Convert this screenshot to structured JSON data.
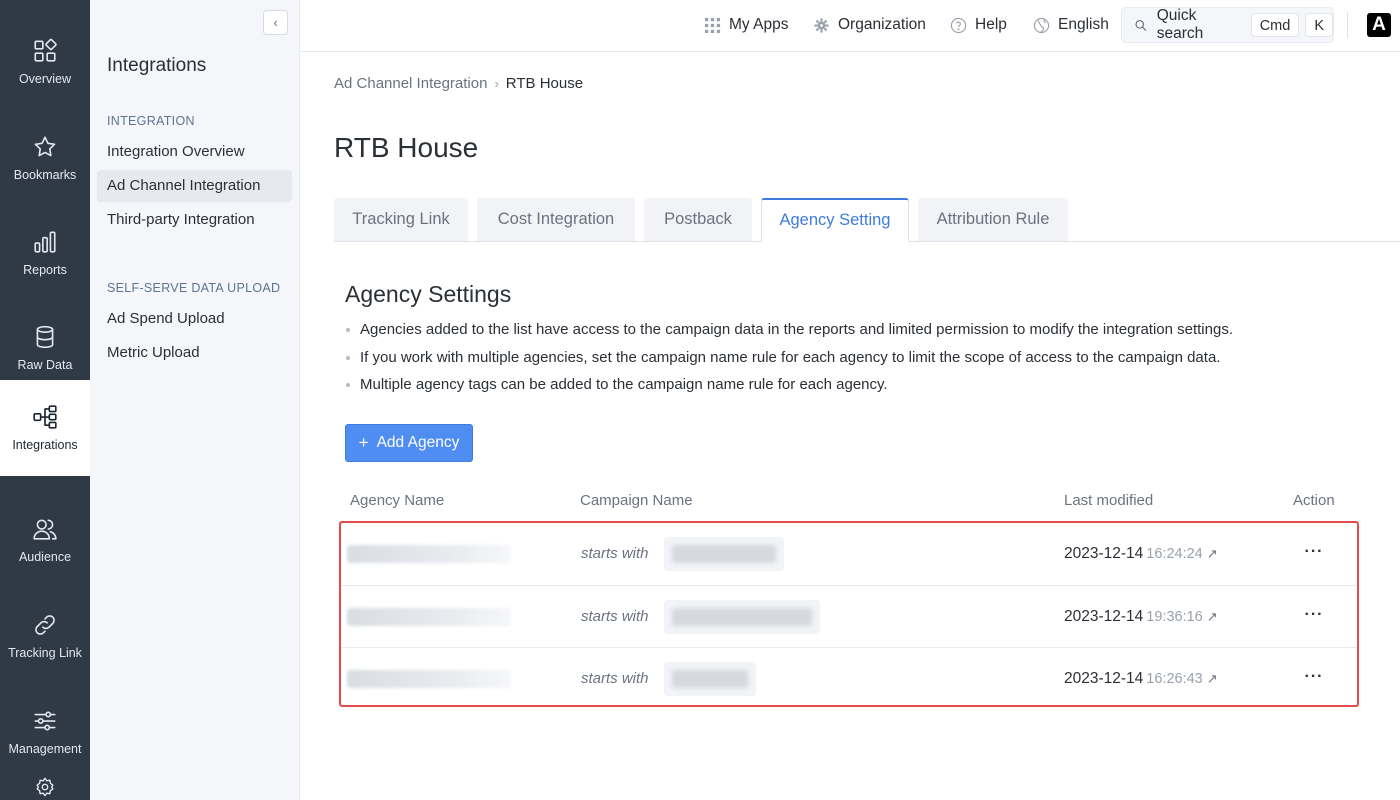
{
  "rail": {
    "items": [
      {
        "label": "Overview",
        "icon": "overview-icon"
      },
      {
        "label": "Bookmarks",
        "icon": "star-icon"
      },
      {
        "label": "Reports",
        "icon": "bar-chart-icon"
      },
      {
        "label": "Raw Data",
        "icon": "database-icon"
      },
      {
        "label": "Integrations",
        "icon": "integrations-icon",
        "active": true
      },
      {
        "label": "Audience",
        "icon": "people-icon"
      },
      {
        "label": "Tracking Link",
        "icon": "link-icon"
      },
      {
        "label": "Management",
        "icon": "sliders-icon"
      }
    ]
  },
  "sidebar": {
    "title": "Integrations",
    "sections": [
      {
        "heading": "INTEGRATION",
        "links": [
          "Integration Overview",
          "Ad Channel Integration",
          "Third-party Integration"
        ]
      },
      {
        "heading": "SELF-SERVE DATA UPLOAD",
        "links": [
          "Ad Spend Upload",
          "Metric Upload"
        ]
      }
    ],
    "active_link": "Ad Channel Integration",
    "collapse_glyph": "‹"
  },
  "topbar": {
    "my_apps": "My Apps",
    "organization": "Organization",
    "help": "Help",
    "language": "English",
    "search_label": "Quick search",
    "shortcut_1": "Cmd",
    "shortcut_2": "K",
    "logo_letter": "A"
  },
  "breadcrumb": {
    "parent": "Ad Channel Integration",
    "separator": "›",
    "current": "RTB House"
  },
  "page_title": "RTB House",
  "tabs": [
    {
      "label": "Tracking Link"
    },
    {
      "label": "Cost Integration"
    },
    {
      "label": "Postback"
    },
    {
      "label": "Agency Setting",
      "active": true
    },
    {
      "label": "Attribution Rule"
    }
  ],
  "agency": {
    "title": "Agency Settings",
    "bullets": [
      "Agencies added to the list have access to the campaign data in the reports and limited permission to modify the integration settings.",
      "If you work with multiple agencies, set the campaign name rule for each agency to limit the scope of access to the campaign data.",
      "Multiple agency tags can be added to the campaign name rule for each agency."
    ],
    "add_button": "Add Agency",
    "add_glyph": "+"
  },
  "table": {
    "columns": [
      "Agency Name",
      "Campaign Name",
      "Last modified",
      "Action"
    ],
    "rows": [
      {
        "rule": "starts with",
        "date": "2023-12-14",
        "time": "16:24:24"
      },
      {
        "rule": "starts with",
        "date": "2023-12-14",
        "time": "19:36:16"
      },
      {
        "rule": "starts with",
        "date": "2023-12-14",
        "time": "16:26:43"
      }
    ],
    "external_glyph": "↗",
    "more_glyph": "···"
  },
  "colors": {
    "rail_bg": "#2f3a46",
    "accent": "#3d7be0",
    "primary_button": "#4f8df2",
    "highlight_frame": "#e34c4c"
  }
}
